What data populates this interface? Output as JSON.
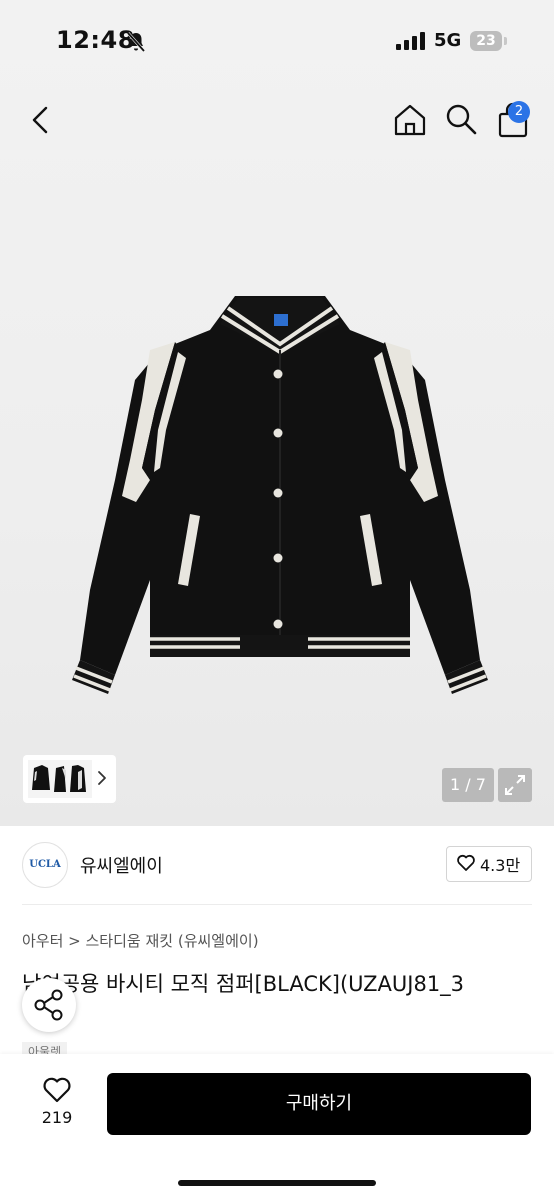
{
  "status_bar": {
    "time": "12:48",
    "network": "5G",
    "battery": "23"
  },
  "header": {
    "cart_count": "2"
  },
  "gallery": {
    "counter": "1 / 7"
  },
  "brand": {
    "logo_text": "UCLA",
    "name": "유씨엘에이",
    "likes": "4.3만"
  },
  "product": {
    "breadcrumb": "아우터 > 스타디움 재킷 (유씨엘에이)",
    "title": "남여공용 바시티 모직 점퍼[BLACK](UZAUJ81_3",
    "tag": "아울렛"
  },
  "bottom_bar": {
    "wish_count": "219",
    "buy_label": "구매하기"
  }
}
